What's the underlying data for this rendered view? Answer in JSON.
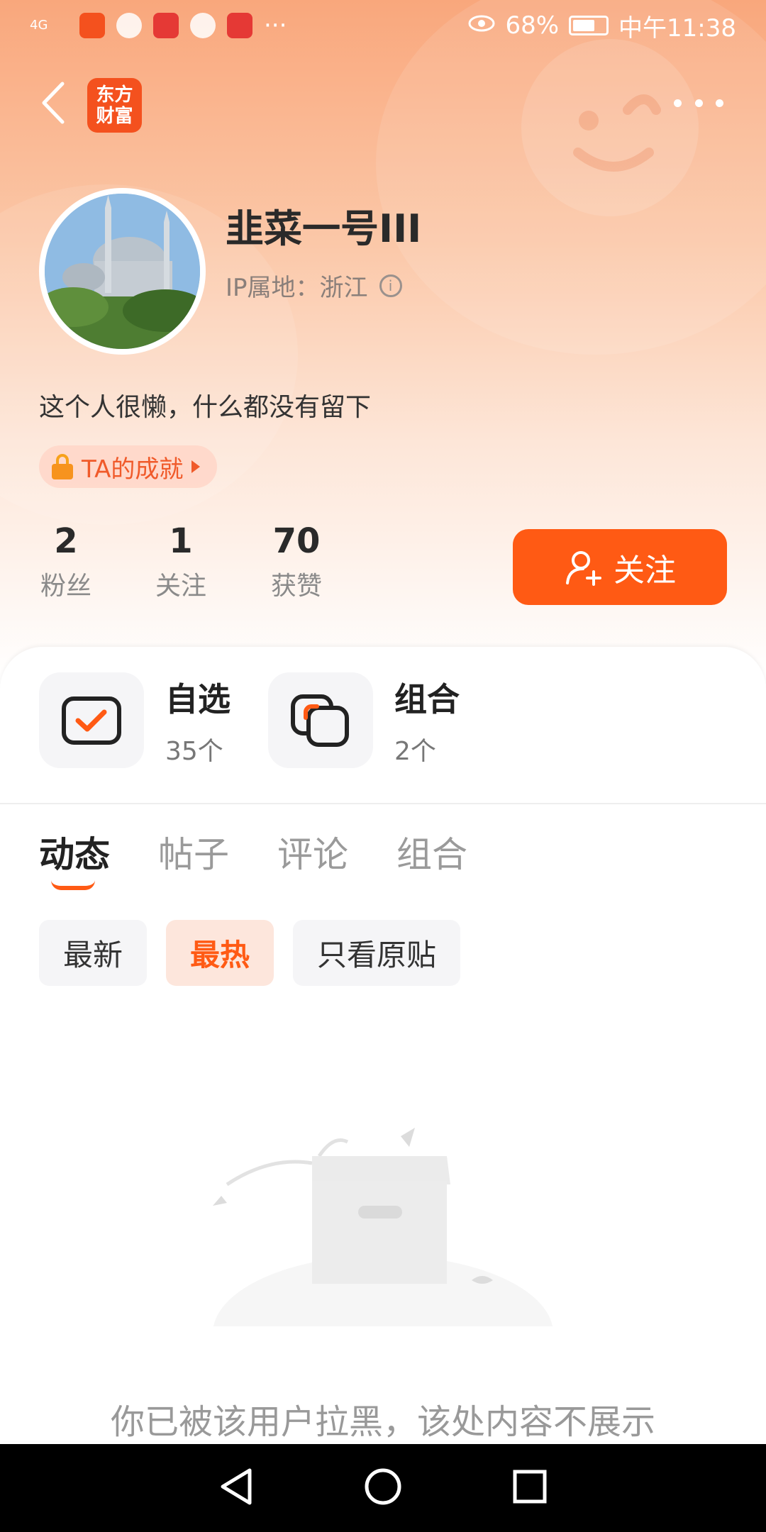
{
  "status_bar": {
    "network": "4G",
    "battery": "68%",
    "time": "中午11:38",
    "app_icons": [
      "app-icon",
      "app-icon",
      "app-icon",
      "chat-icon",
      "app-icon"
    ],
    "more": "···"
  },
  "header": {
    "logo_line1": "东方",
    "logo_line2": "财富"
  },
  "profile": {
    "username": "韭菜一号III",
    "ip_location": "IP属地：浙江",
    "bio": "这个人很懒，什么都没有留下",
    "achievement": "TA的成就"
  },
  "stats": [
    {
      "value": "2",
      "label": "粉丝"
    },
    {
      "value": "1",
      "label": "关注"
    },
    {
      "value": "70",
      "label": "获赞"
    }
  ],
  "follow_button": "关注",
  "features": [
    {
      "title": "自选",
      "count": "35个"
    },
    {
      "title": "组合",
      "count": "2个"
    }
  ],
  "tabs": [
    "动态",
    "帖子",
    "评论",
    "组合"
  ],
  "filters": [
    "最新",
    "最热",
    "只看原贴"
  ],
  "empty_message": "你已被该用户拉黑，该处内容不展示",
  "colors": {
    "accent": "#ff5a14",
    "header_gradient_top": "#f9a77c"
  }
}
